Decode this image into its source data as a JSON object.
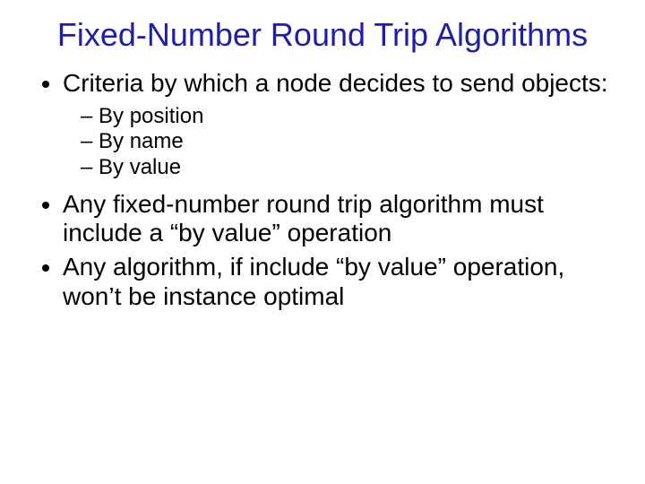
{
  "title": "Fixed-Number Round Trip Algorithms",
  "bullets": [
    {
      "text": "Criteria by which a node decides to send objects:",
      "sub": [
        "By position",
        "By name",
        "By value"
      ]
    },
    {
      "text": "Any fixed-number round trip algorithm must include a “by value” operation"
    },
    {
      "text": "Any algorithm, if include “by value” operation, won’t be instance optimal"
    }
  ]
}
